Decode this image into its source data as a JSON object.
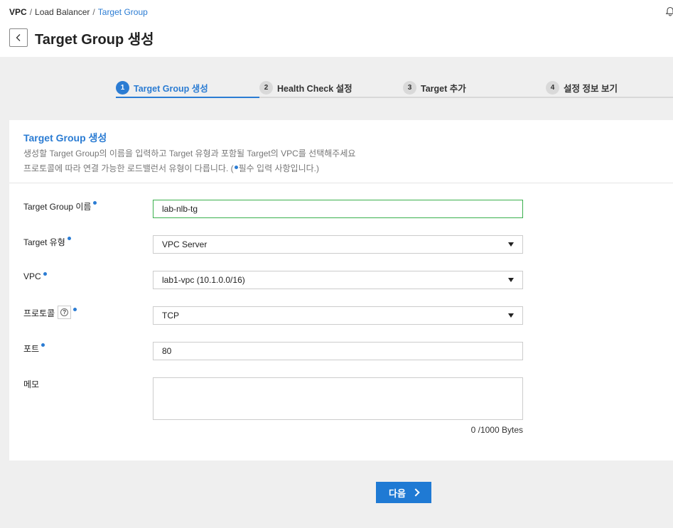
{
  "breadcrumb": {
    "items": [
      "VPC",
      "Load Balancer",
      "Target Group"
    ],
    "sep": "/"
  },
  "header": {
    "title": "Target Group 생성",
    "back_icon": "chevron-left-icon",
    "notification_icon": "bell-icon"
  },
  "steps": [
    {
      "num": "1",
      "label": "Target Group 생성",
      "active": true
    },
    {
      "num": "2",
      "label": "Health Check 설정",
      "active": false
    },
    {
      "num": "3",
      "label": "Target 추가",
      "active": false
    },
    {
      "num": "4",
      "label": "설정 정보 보기",
      "active": false
    }
  ],
  "section": {
    "title": "Target Group 생성",
    "desc1": "생성할 Target Group의 이름을 입력하고 Target 유형과 포함될 Target의 VPC를 선택해주세요",
    "desc2_before": "프로토콜에 따라 연결 가능한 로드밸런서 유형이 다릅니다. (",
    "desc2_after": "필수 입력 사항입니다.)"
  },
  "form": {
    "name": {
      "label": "Target Group 이름",
      "value": "lab-nlb-tg"
    },
    "type": {
      "label": "Target 유형",
      "value": "VPC Server"
    },
    "vpc": {
      "label": "VPC",
      "value": "lab1-vpc (10.1.0.0/16)"
    },
    "protocol": {
      "label": "프로토콜",
      "value": "TCP",
      "help_icon": "question-circle-icon"
    },
    "port": {
      "label": "포트",
      "value": "80"
    },
    "memo": {
      "label": "메모",
      "value": "",
      "counter": "0 /1000 Bytes"
    }
  },
  "actions": {
    "next_label": "다음"
  },
  "colors": {
    "accent": "#2b7cd3",
    "focus_border": "#3ab04d",
    "button": "#1f7ad4"
  }
}
